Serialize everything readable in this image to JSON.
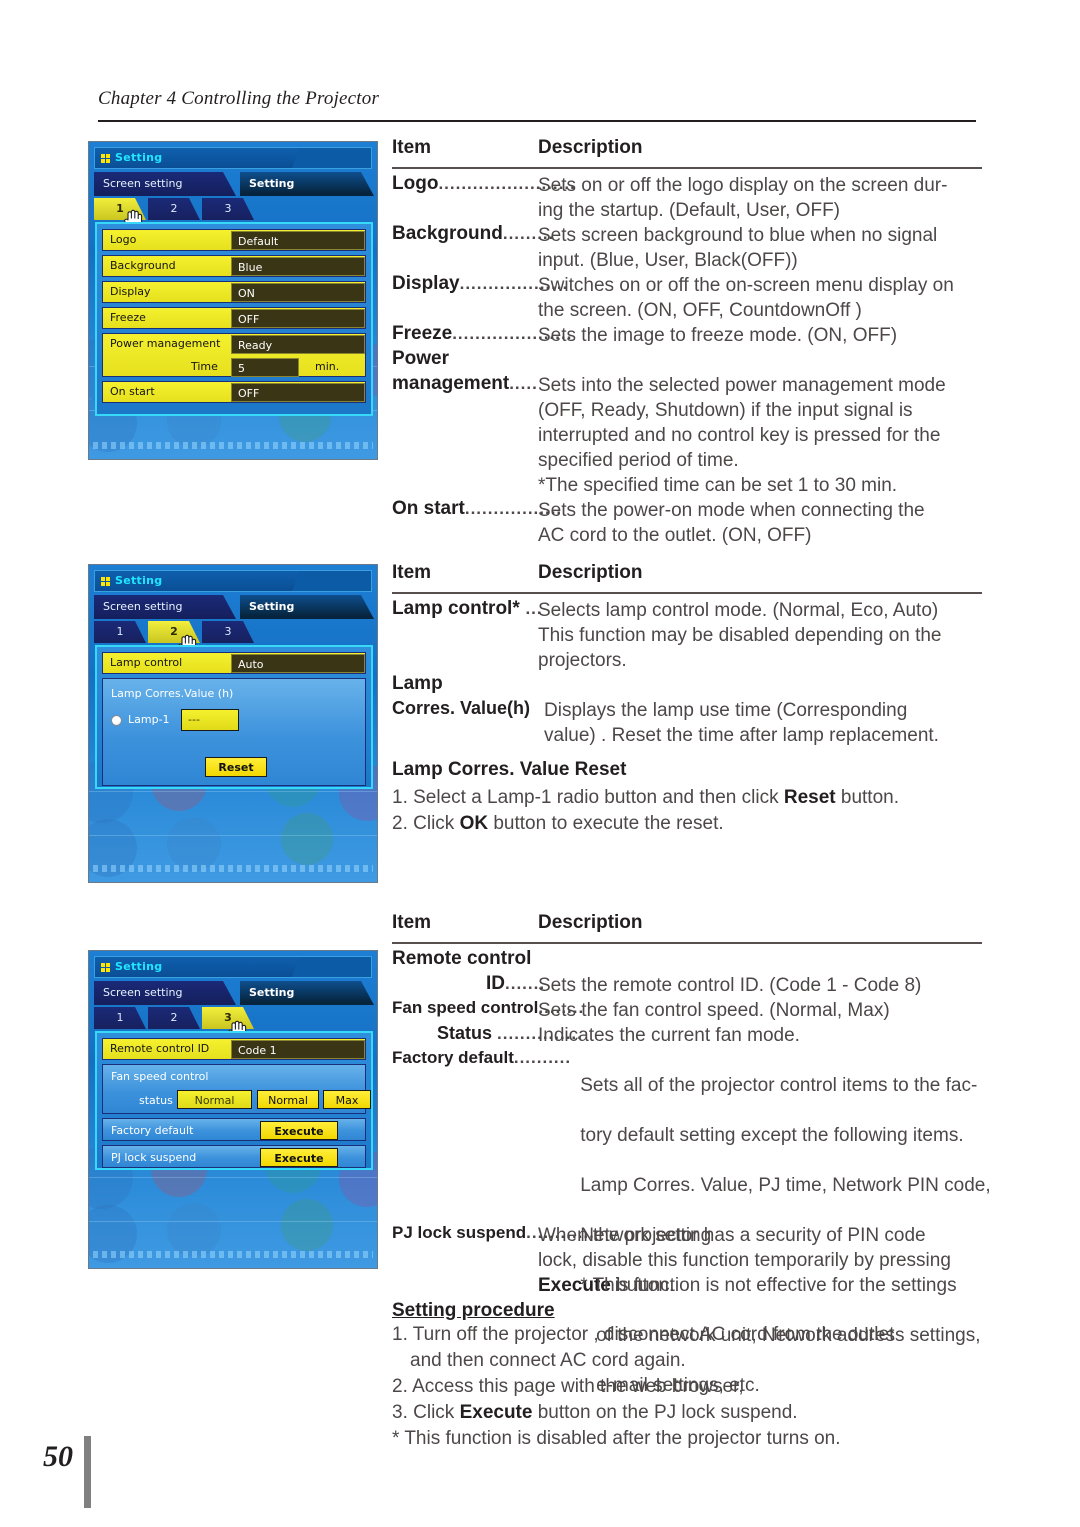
{
  "header": {
    "chapter": "Chapter 4 Controlling the Projector"
  },
  "footer": {
    "page_number": "50"
  },
  "table_headers": {
    "item": "Item",
    "description": "Description"
  },
  "screenshots": [
    {
      "id": "setting-tab-1",
      "title": "Setting",
      "main_tabs": [
        {
          "label": "Screen setting",
          "active": false
        },
        {
          "label": "Setting",
          "active": true
        }
      ],
      "sub_tabs": [
        {
          "label": "1",
          "active": true
        },
        {
          "label": "2",
          "active": false
        },
        {
          "label": "3",
          "active": false
        }
      ],
      "rows": [
        {
          "label": "Logo",
          "value": "Default"
        },
        {
          "label": "Background",
          "value": "Blue"
        },
        {
          "label": "Display",
          "value": "ON"
        },
        {
          "label": "Freeze",
          "value": "OFF"
        },
        {
          "label": "Power management",
          "value": "Ready"
        },
        {
          "label": "Time",
          "value": "5",
          "unit": "min."
        },
        {
          "label": "On start",
          "value": "OFF"
        }
      ]
    },
    {
      "id": "setting-tab-2",
      "title": "Setting",
      "main_tabs": [
        {
          "label": "Screen setting",
          "active": false
        },
        {
          "label": "Setting",
          "active": true
        }
      ],
      "sub_tabs": [
        {
          "label": "1",
          "active": false
        },
        {
          "label": "2",
          "active": true
        },
        {
          "label": "3",
          "active": false
        }
      ],
      "lamp_control_label": "Lamp control",
      "lamp_control_value": "Auto",
      "lamp_corres_label": "Lamp Corres.Value (h)",
      "lamp1_label": "Lamp-1",
      "lamp1_value": "---",
      "reset_button": "Reset"
    },
    {
      "id": "setting-tab-3",
      "title": "Setting",
      "main_tabs": [
        {
          "label": "Screen setting",
          "active": false
        },
        {
          "label": "Setting",
          "active": true
        }
      ],
      "sub_tabs": [
        {
          "label": "1",
          "active": false
        },
        {
          "label": "2",
          "active": false
        },
        {
          "label": "3",
          "active": true
        }
      ],
      "remote_id_label": "Remote control ID",
      "remote_id_value": "Code 1",
      "fan_speed_label": "Fan speed control",
      "fan_status_label": "status",
      "fan_status_value": "Normal",
      "fan_btn_normal": "Normal",
      "fan_btn_max": "Max",
      "factory_default_label": "Factory default",
      "factory_default_button": "Execute",
      "pj_lock_label": "PJ lock suspend",
      "pj_lock_button": "Execute"
    }
  ],
  "table1": {
    "rows": [
      {
        "item": "Logo",
        "dots": "........................",
        "lines": [
          "Sets on or off the logo display on the screen dur-",
          "ing the startup. (Default, User, OFF)"
        ]
      },
      {
        "item": "Background",
        "dots": ".........",
        "lines": [
          "Sets screen background to blue when no signal",
          "input. (Blue, User, Black(OFF))"
        ]
      },
      {
        "item": "Display",
        "dots": "...................",
        "lines": [
          "Switches on or off the on-screen menu display on",
          "the screen. (ON, OFF, CountdownOff )"
        ]
      },
      {
        "item": "Freeze",
        "dots": ".....................",
        "lines": [
          "Sets the image to freeze mode. (ON, OFF)"
        ]
      },
      {
        "item": "Power",
        "dots": "",
        "lines": []
      },
      {
        "item": "management",
        "dots": ".....",
        "lines": [
          "Sets into the selected power management mode",
          "(OFF, Ready, Shutdown) if the input signal is",
          "interrupted and no control key is pressed for the",
          "specified period of time.",
          "*The specified time can be set 1 to 30 min."
        ]
      },
      {
        "item": "On start",
        "dots": ".................",
        "lines": [
          "Sets the power-on mode when connecting the",
          "AC cord to the outlet. (ON, OFF)"
        ]
      }
    ]
  },
  "table2": {
    "rows": [
      {
        "item": "Lamp control*",
        "dots": " ...",
        "lines": [
          "Selects lamp control mode. (Normal, Eco, Auto)",
          "This function may be disabled depending on the",
          "projectors."
        ]
      },
      {
        "item": "Lamp",
        "dots": "",
        "lines": []
      },
      {
        "item": "Corres. Value(h)",
        "dots": "",
        "lines": [
          "Displays the lamp use time (Corresponding",
          "value) . Reset the time after lamp replacement."
        ]
      }
    ],
    "reset_heading": "Lamp Corres. Value Reset",
    "reset_steps": [
      {
        "prefix": "1. Select a Lamp-1 radio button and then click ",
        "bold": "Reset",
        "suffix": " button."
      },
      {
        "prefix": "2. Click ",
        "bold": "OK",
        "suffix": " button to execute the reset."
      }
    ]
  },
  "table3": {
    "rows": [
      {
        "item": "Remote control",
        "dots": "",
        "indent": 0,
        "lines": []
      },
      {
        "item": "ID",
        "dots": ".......",
        "indent": 94,
        "lines": [
          "Sets the remote control ID. (Code 1 - Code 8)"
        ]
      },
      {
        "item": "Fan speed control",
        "dots": "........",
        "indent": 0,
        "small": true,
        "lines": [
          "Sets the fan control speed. (Normal, Max)"
        ]
      },
      {
        "item": "Status",
        "dots": "...............",
        "indent": 45,
        "lines": [
          "Indicates the current fan mode."
        ]
      },
      {
        "item": "Factory default",
        "dots": "..........",
        "indent": 0,
        "small": true,
        "lines": [
          "Sets all of the projector control items to the fac-",
          "tory default setting except the following items.",
          "Lamp Corres. Value, PJ time, Network PIN code,",
          "Network setting",
          "* This function is not effective for the settings",
          "   of the network unit, Network address settings,",
          "   e-mail settings, etc."
        ]
      },
      {
        "item": "PJ lock suspend",
        "dots": "............",
        "indent": 0,
        "small": true,
        "lines": [
          "When the projector has a security of PIN code",
          "lock, disable this function temporarily by pressing"
        ]
      }
    ],
    "execute_line": {
      "bold": "Execute",
      "suffix": " button."
    },
    "procedure_heading": "Setting procedure",
    "procedure_steps": [
      {
        "text": "1. Turn off the projector , disconnect AC cord from the outlet"
      },
      {
        "text": "and then connect AC cord again.",
        "indent": true
      },
      {
        "text": "2. Access this page with the web browser,"
      },
      {
        "prefix": "3. Click ",
        "bold": "Execute",
        "suffix": " button on the PJ lock suspend."
      },
      {
        "text": "* This function is disabled after the projector turns on."
      }
    ]
  }
}
